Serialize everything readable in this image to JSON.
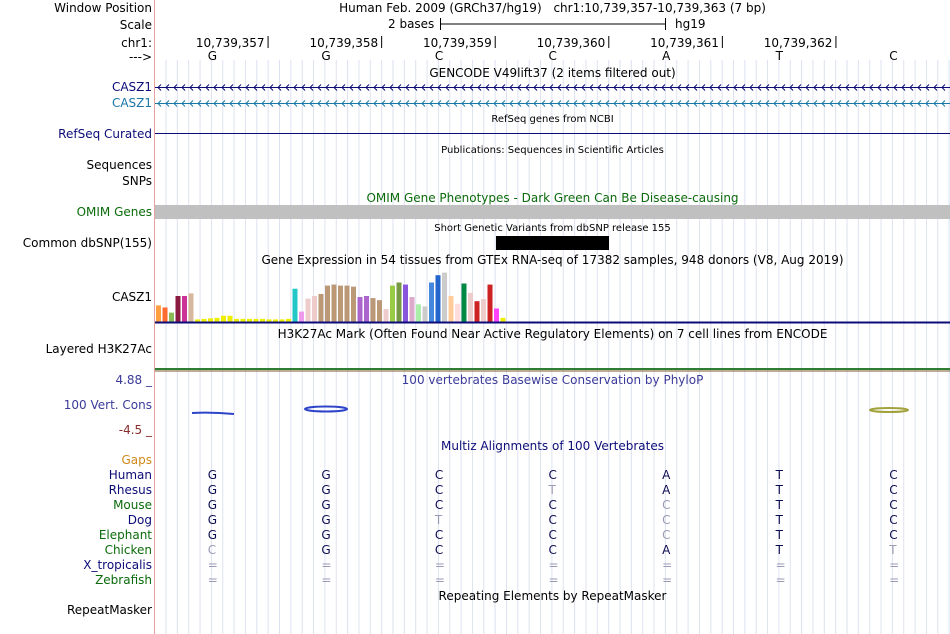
{
  "header": {
    "window_position_label": "Window Position",
    "scale_label": "Scale",
    "chrom_label": "chr1:",
    "strand_label": "--->",
    "assembly": "Human Feb. 2009 (GRCh37/hg19)",
    "position": "chr1:10,739,357-10,739,363 (7 bp)",
    "scale_text": "2 bases",
    "db": "hg19",
    "coordinates": [
      "10,739,357",
      "10,739,358",
      "10,739,359",
      "10,739,360",
      "10,739,361",
      "10,739,362"
    ],
    "bases": [
      "G",
      "G",
      "C",
      "C",
      "A",
      "T",
      "C"
    ]
  },
  "tracks": {
    "gencode": {
      "title": "GENCODE V49lift37 (2 items filtered out)",
      "items": [
        "CASZ1",
        "CASZ1"
      ],
      "colors": [
        "#0c0c78",
        "#1a77a8"
      ]
    },
    "refseq": {
      "label": "RefSeq Curated",
      "title": "RefSeq genes from NCBI",
      "color": "#0c0c78"
    },
    "publications": {
      "title": "Publications: Sequences in Scientific Articles",
      "labels": [
        "Sequences",
        "SNPs"
      ]
    },
    "omim": {
      "label": "OMIM Genes",
      "title": "OMIM Gene Phenotypes - Dark Green Can Be Disease-causing",
      "color": "#0b6b0b",
      "bar_color": "#c0c0c0"
    },
    "dbsnp": {
      "label": "Common dbSNP(155)",
      "title": "Short Genetic Variants from dbSNP release 155"
    },
    "gtex": {
      "label": "CASZ1",
      "title": "Gene Expression in 54 tissues from GTEx RNA-seq of 17382 samples, 948 donors (V8, Aug 2019)",
      "values": [
        0.32,
        0.28,
        0.18,
        0.5,
        0.5,
        0.55,
        0.05,
        0.06,
        0.07,
        0.08,
        0.12,
        0.12,
        0.06,
        0.06,
        0.06,
        0.06,
        0.06,
        0.05,
        0.05,
        0.05,
        0.06,
        0.64,
        0.2,
        0.45,
        0.5,
        0.54,
        0.7,
        0.72,
        0.7,
        0.7,
        0.68,
        0.48,
        0.5,
        0.46,
        0.42,
        0.25,
        0.7,
        0.76,
        0.72,
        0.48,
        0.34,
        0.3,
        0.76,
        0.9,
        0.95,
        0.5,
        0.35,
        0.74,
        0.56,
        0.4,
        0.44,
        0.72,
        0.26,
        0.08
      ],
      "colors": [
        "#ff9f40",
        "#ff6a30",
        "#88bb55",
        "#8b1a42",
        "#cc3399",
        "#d8b89c",
        "#eeee00",
        "#eeee00",
        "#eeee00",
        "#eeee00",
        "#eeee00",
        "#eeee00",
        "#eeee00",
        "#eeee00",
        "#eeee00",
        "#eeee00",
        "#eeee00",
        "#eeee00",
        "#eeee00",
        "#eeee00",
        "#eeee00",
        "#22c8c8",
        "#ee99ee",
        "#eecccc",
        "#eecccc",
        "#bb9977",
        "#bb9977",
        "#bb9977",
        "#bb9977",
        "#bb9977",
        "#bb9977",
        "#aa66cc",
        "#aa66cc",
        "#bb9977",
        "#bb9977",
        "#eecccc",
        "#99cc44",
        "#779944",
        "#8855dd",
        "#ddaacc",
        "#aaeeaa",
        "#cccccc",
        "#4488dd",
        "#2266cc",
        "#cccccc",
        "#ffcc99",
        "#ffdddd",
        "#008844",
        "#eecccc",
        "#cc2222",
        "#eecccc",
        "#cc2222",
        "#ff44ff",
        "#eeee00"
      ]
    },
    "h3k27ac": {
      "label": "Layered H3K27Ac",
      "title": "H3K27Ac Mark (Often Found Near Active Regulatory Elements) on 7 cell lines from ENCODE"
    },
    "phylop": {
      "label": "100 Vert. Cons",
      "title": "100 vertebrates Basewise Conservation by PhyloP",
      "max": "4.88 _",
      "min": "-4.5 _"
    },
    "multiz": {
      "title": "Multiz Alignments of 100 Vertebrates",
      "gaps_label": "Gaps",
      "rows": [
        {
          "species": "Human",
          "bases": [
            "G",
            "G",
            "C",
            "C",
            "A",
            "T",
            "C"
          ],
          "faded": [
            false,
            false,
            false,
            false,
            false,
            false,
            false
          ]
        },
        {
          "species": "Rhesus",
          "bases": [
            "G",
            "G",
            "C",
            "T",
            "A",
            "T",
            "C"
          ],
          "faded": [
            false,
            false,
            false,
            true,
            false,
            false,
            false
          ]
        },
        {
          "species": "Mouse",
          "bases": [
            "G",
            "G",
            "C",
            "C",
            "C",
            "T",
            "C"
          ],
          "faded": [
            false,
            false,
            false,
            false,
            true,
            false,
            false
          ]
        },
        {
          "species": "Dog",
          "bases": [
            "G",
            "G",
            "T",
            "C",
            "C",
            "T",
            "C"
          ],
          "faded": [
            false,
            false,
            true,
            false,
            true,
            false,
            false
          ]
        },
        {
          "species": "Elephant",
          "bases": [
            "G",
            "G",
            "C",
            "C",
            "C",
            "T",
            "C"
          ],
          "faded": [
            false,
            false,
            false,
            false,
            true,
            false,
            false
          ]
        },
        {
          "species": "Chicken",
          "bases": [
            "C",
            "G",
            "C",
            "C",
            "A",
            "T",
            "T"
          ],
          "faded": [
            true,
            false,
            false,
            false,
            false,
            false,
            true
          ]
        },
        {
          "species": "X_tropicalis",
          "bases": [
            "=",
            "=",
            "=",
            "=",
            "=",
            "=",
            "="
          ],
          "faded": [
            true,
            true,
            true,
            true,
            true,
            true,
            true
          ]
        },
        {
          "species": "Zebrafish",
          "bases": [
            "=",
            "=",
            "=",
            "=",
            "=",
            "=",
            "="
          ],
          "faded": [
            true,
            true,
            true,
            true,
            true,
            true,
            true
          ]
        }
      ],
      "species_colors": [
        "#0c0c78",
        "#0c0c78",
        "#0b6b0b",
        "#0c0c78",
        "#0b6b0b",
        "#0b6b0b",
        "#0c0c78",
        "#0b6b0b"
      ]
    },
    "repeatmasker": {
      "label": "RepeatMasker",
      "title": "Repeating Elements by RepeatMasker"
    }
  },
  "colors": {
    "dark_blue": "#0c0c78",
    "dark_green": "#0b6b0b",
    "gaps_orange": "#d08a1c",
    "phylop_blue": "#3b3b9a",
    "phylop_min": "#8a2c2c"
  }
}
